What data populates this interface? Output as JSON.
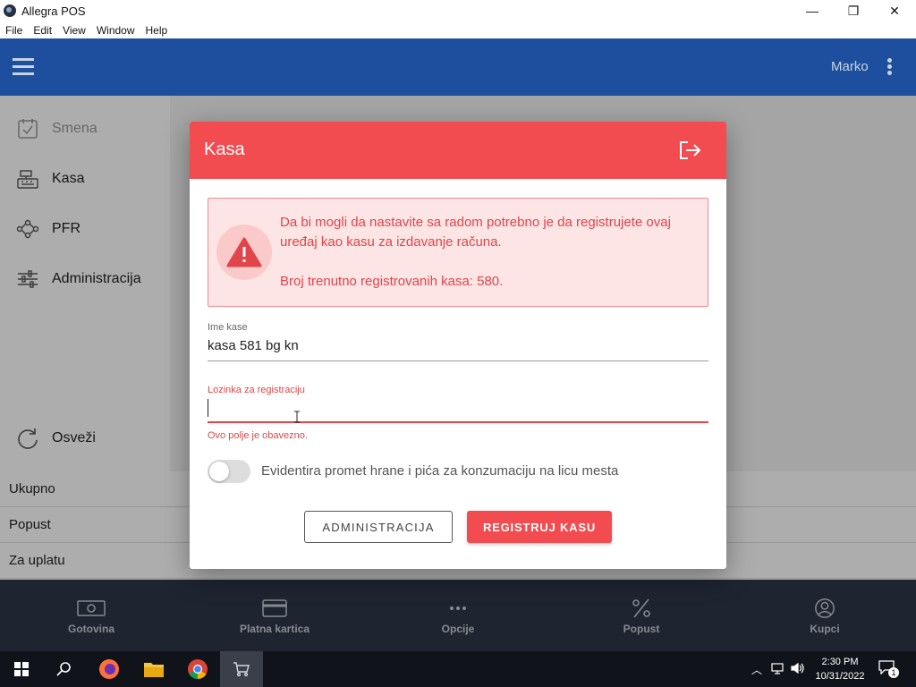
{
  "window": {
    "title": "Allegra POS",
    "minimize": "—",
    "maximize": "❐",
    "close": "✕"
  },
  "menu": [
    "File",
    "Edit",
    "View",
    "Window",
    "Help"
  ],
  "header": {
    "user": "Marko"
  },
  "sidebar": {
    "items": [
      {
        "label": "Smena",
        "icon": "calendar-check-icon",
        "disabled": true
      },
      {
        "label": "Kasa",
        "icon": "cash-register-icon"
      },
      {
        "label": "PFR",
        "icon": "network-icon"
      },
      {
        "label": "Administracija",
        "icon": "sliders-icon"
      }
    ],
    "refresh_label": "Osveži"
  },
  "totals": [
    "Ukupno",
    "Popust",
    "Za uplatu"
  ],
  "bottom_nav": [
    "Gotovina",
    "Platna kartica",
    "Opcije",
    "Popust",
    "Kupci"
  ],
  "dialog": {
    "title": "Kasa",
    "alert": {
      "message": "Da bi mogli da nastavite sa radom potrebno je da registrujete ovaj uređaj kao kasu za izdavanje računa.",
      "count_text": "Broj trenutno registrovanih kasa: 580."
    },
    "name_field": {
      "label": "Ime kase",
      "value": "kasa 581 bg kn"
    },
    "password_field": {
      "label": "Lozinka za registraciju",
      "value": "",
      "error": "Ovo polje je obavezno."
    },
    "toggle": {
      "label": "Evidentira promet hrane i pića za konzumaciju na licu mesta",
      "on": false
    },
    "buttons": {
      "secondary": "ADMINISTRACIJA",
      "primary": "REGISTRUJ KASU"
    }
  },
  "colors": {
    "accent": "#f24b50",
    "header_blue": "#1d4f9e",
    "bottom_bar": "#2d3548"
  },
  "taskbar": {
    "time": "2:30 PM",
    "date": "10/31/2022",
    "notifications": "1"
  }
}
